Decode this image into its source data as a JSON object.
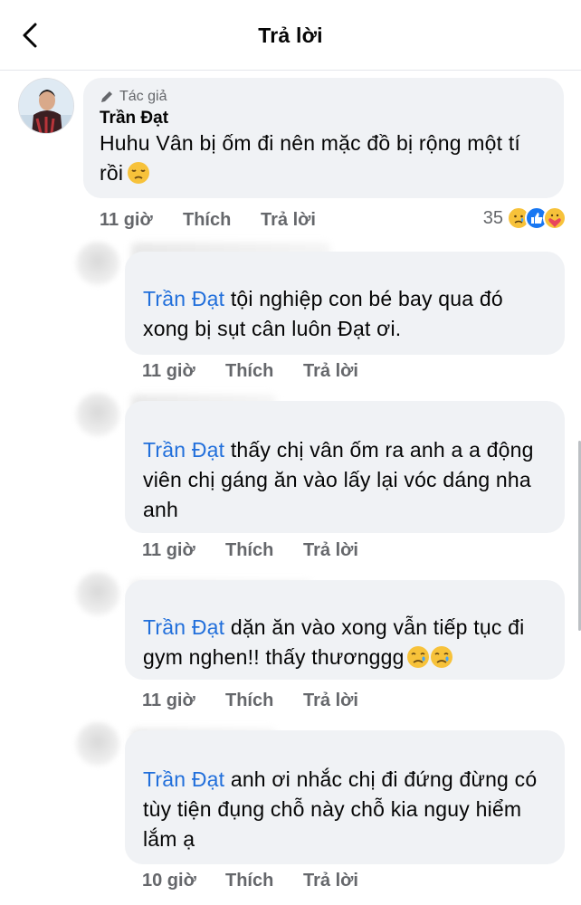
{
  "header": {
    "title": "Trả lời",
    "back_icon": "chevron-left-icon"
  },
  "main_comment": {
    "author_badge": "Tác giả",
    "author_name": "Trần Đạt",
    "text": "Huhu Vân bị ốm đi nên mặc đồ bị rộng một tí rồi",
    "emoji": "pensive-face",
    "time": "11 giờ",
    "like_label": "Thích",
    "reply_label": "Trả lời",
    "reaction_count": "35",
    "reactions": [
      "sad",
      "like",
      "care"
    ]
  },
  "replies": [
    {
      "mention": "Trần Đạt",
      "text": " tội nghiệp con bé bay qua đó xong bị sụt cân luôn Đạt ơi.",
      "time": "11 giờ",
      "like_label": "Thích",
      "reply_label": "Trả lời"
    },
    {
      "mention": "Trần Đạt",
      "text": " thấy chị vân ốm ra anh a a động viên chị gáng ăn vào lấy lại vóc dáng nha anh",
      "time": "11 giờ",
      "like_label": "Thích",
      "reply_label": "Trả lời"
    },
    {
      "mention": "Trần Đạt",
      "text": " dặn ăn vào xong vẫn tiếp tục đi gym nghen!! thấy thươnggg",
      "emojis": [
        "crying-face",
        "crying-face"
      ],
      "time": "11 giờ",
      "like_label": "Thích",
      "reply_label": "Trả lời"
    },
    {
      "mention": "Trần Đạt",
      "text": " anh ơi nhắc chị đi đứng đừng có tùy tiện đụng chỗ này chỗ kia nguy hiểm lắm ạ",
      "time": "10 giờ",
      "like_label": "Thích",
      "reply_label": "Trả lời"
    }
  ],
  "colors": {
    "bubble": "#f0f2f5",
    "mention": "#216fdb",
    "secondary_text": "#65676b"
  }
}
